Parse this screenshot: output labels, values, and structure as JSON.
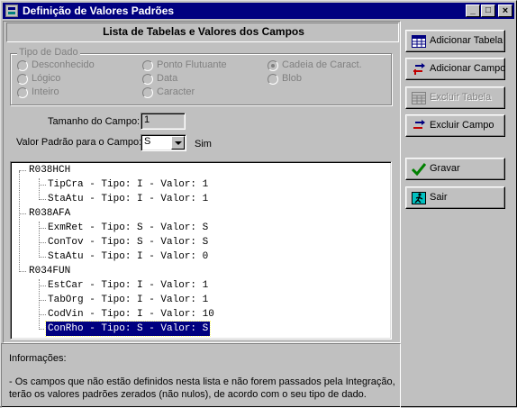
{
  "window": {
    "title": "Definição de Valores Padrões",
    "minimize": "_",
    "maximize": "□",
    "close": "×"
  },
  "header": {
    "title": "Lista de Tabelas e Valores dos Campos"
  },
  "tipo_dado": {
    "label": "Tipo de Dado",
    "options": [
      {
        "label": "Desconhecido",
        "checked": false
      },
      {
        "label": "Lógico",
        "checked": false
      },
      {
        "label": "Inteiro",
        "checked": false
      },
      {
        "label": "Ponto Flutuante",
        "checked": false
      },
      {
        "label": "Data",
        "checked": false
      },
      {
        "label": "Caracter",
        "checked": false
      },
      {
        "label": "Cadeia de Caract.",
        "checked": true
      },
      {
        "label": "Blob",
        "checked": false
      }
    ]
  },
  "fields": {
    "tamanho_label": "Tamanho do Campo:",
    "tamanho_value": "1",
    "valor_label": "Valor Padrão para o Campo:",
    "valor_value": "S",
    "valor_desc": "Sim"
  },
  "tree": {
    "tables": [
      {
        "name": "R038HCH",
        "fields": [
          "TipCra - Tipo: I - Valor: 1",
          "StaAtu - Tipo: I - Valor: 1"
        ]
      },
      {
        "name": "R038AFA",
        "fields": [
          "ExmRet - Tipo: S - Valor: S",
          "ConTov - Tipo: S - Valor: S",
          "StaAtu - Tipo: I - Valor: 0"
        ]
      },
      {
        "name": "R034FUN",
        "fields": [
          "EstCar - Tipo: I - Valor: 1",
          "TabOrg - Tipo: I - Valor: 1",
          "CodVin - Tipo: I - Valor: 10",
          "ConRho - Tipo: S - Valor: S"
        ]
      }
    ],
    "selected": "ConRho - Tipo: S - Valor: S"
  },
  "info": {
    "title": "Informações:",
    "line1": "- Os campos que não estão definidos nesta lista e não forem passados pela Integração,",
    "line2": "terão os valores padrões zerados (não nulos), de acordo com o seu tipo de dado."
  },
  "buttons": {
    "adicionar_tabela": "Adicionar Tabela",
    "adicionar_campo": "Adicionar Campo",
    "excluir_tabela": "Excluir Tabela",
    "excluir_campo": "Excluir Campo",
    "gravar": "Gravar",
    "sair": "Sair"
  },
  "colors": {
    "titlebar": "#000080",
    "face": "#c0c0c0",
    "selection": "#000080"
  }
}
